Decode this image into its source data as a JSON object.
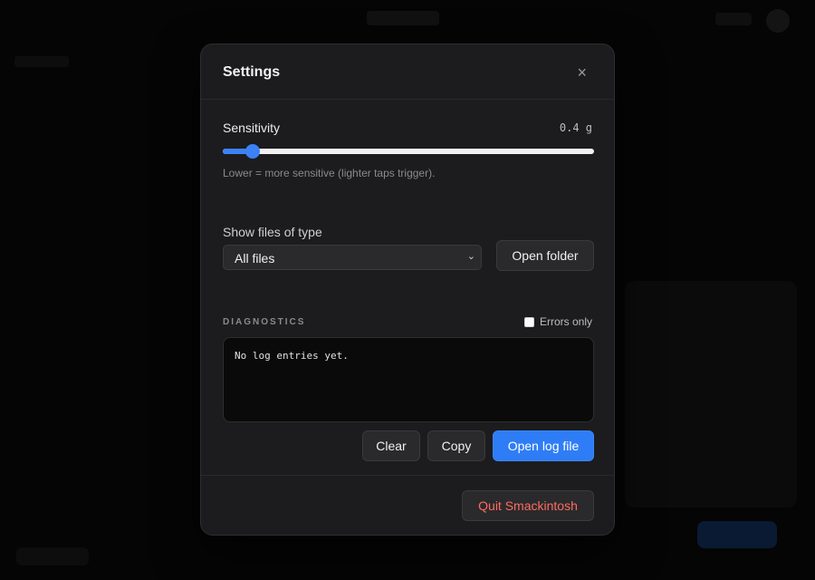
{
  "colors": {
    "accent": "#2f7df6",
    "danger": "#ff6b5f",
    "background": "#1c1c1e"
  },
  "settings": {
    "title": "Settings",
    "close_icon": "×"
  },
  "sensitivity": {
    "label": "Sensitivity",
    "value_text": "0.4 g",
    "slider_fraction": 0.08,
    "hint": "Lower = more sensitive (lighter taps trigger)."
  },
  "files": {
    "label": "Show files of type",
    "selected": "All files",
    "arrow_icon": "⌄",
    "open_folder_label": "Open folder"
  },
  "diagnostics": {
    "label": "DIAGNOSTICS",
    "errors_only_label": "Errors only",
    "errors_only_checked": false,
    "log_text": "No log entries yet.",
    "clear_label": "Clear",
    "copy_label": "Copy",
    "open_log_label": "Open log file"
  },
  "footer": {
    "quit_label": "Quit Smackintosh"
  }
}
